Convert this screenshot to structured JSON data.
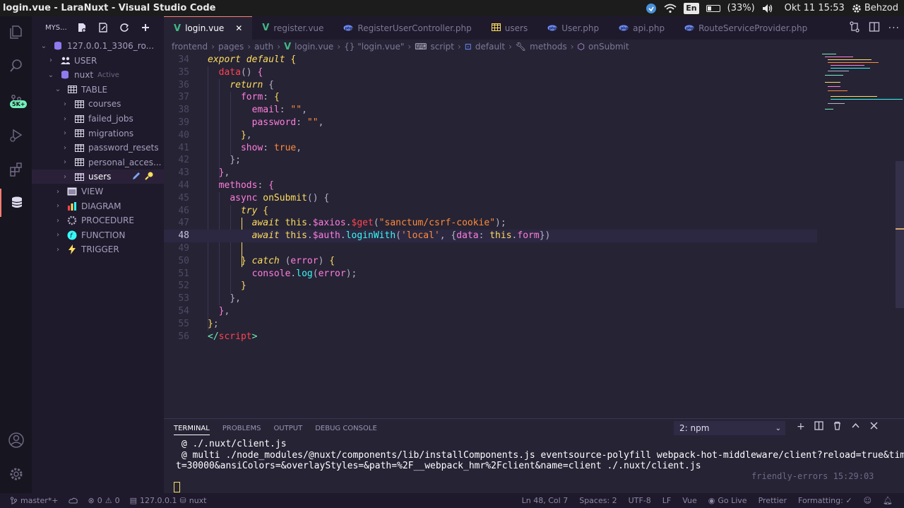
{
  "os": {
    "window_title": "login.vue - LaraNuxt - Visual Studio Code",
    "language": "En",
    "battery": "(33%)",
    "datetime": "Okt 11 15:53",
    "user": "Behzod"
  },
  "activity": {
    "badge": "5K+"
  },
  "sidebar": {
    "header": "MYS...",
    "tree": [
      {
        "label": "127.0.0.1_3306_ro...",
        "depth": 0,
        "chev": "⌄",
        "icon": "db"
      },
      {
        "label": "USER",
        "depth": 1,
        "chev": "›",
        "icon": "users"
      },
      {
        "label": "nuxt",
        "depth": 1,
        "chev": "⌄",
        "icon": "db",
        "tag": "Active"
      },
      {
        "label": "TABLE",
        "depth": 2,
        "chev": "⌄",
        "icon": "table"
      },
      {
        "label": "courses",
        "depth": 3,
        "chev": "›",
        "icon": "table"
      },
      {
        "label": "failed_jobs",
        "depth": 3,
        "chev": "›",
        "icon": "table"
      },
      {
        "label": "migrations",
        "depth": 3,
        "chev": "›",
        "icon": "table"
      },
      {
        "label": "password_resets",
        "depth": 3,
        "chev": "›",
        "icon": "table"
      },
      {
        "label": "personal_acces...",
        "depth": 3,
        "chev": "›",
        "icon": "table"
      },
      {
        "label": "users",
        "depth": 3,
        "chev": "›",
        "icon": "table",
        "selected": true
      },
      {
        "label": "VIEW",
        "depth": 2,
        "chev": "›",
        "icon": "view"
      },
      {
        "label": "DIAGRAM",
        "depth": 2,
        "chev": "›",
        "icon": "diagram"
      },
      {
        "label": "PROCEDURE",
        "depth": 2,
        "chev": "›",
        "icon": "procedure"
      },
      {
        "label": "FUNCTION",
        "depth": 2,
        "chev": "›",
        "icon": "function"
      },
      {
        "label": "TRIGGER",
        "depth": 2,
        "chev": "›",
        "icon": "trigger"
      }
    ]
  },
  "tabs": [
    {
      "label": "login.vue",
      "kind": "vue",
      "active": true
    },
    {
      "label": "register.vue",
      "kind": "vue"
    },
    {
      "label": "RegisterUserController.php",
      "kind": "php"
    },
    {
      "label": "users",
      "kind": "table"
    },
    {
      "label": "User.php",
      "kind": "php"
    },
    {
      "label": "api.php",
      "kind": "php"
    },
    {
      "label": "RouteServiceProvider.php",
      "kind": "php"
    }
  ],
  "breadcrumbs": [
    "frontend",
    "pages",
    "auth",
    "login.vue",
    "{} \"login.vue\"",
    "script",
    "default",
    "methods",
    "onSubmit"
  ],
  "editor": {
    "current_line": 48,
    "lines": [
      {
        "n": 34,
        "tokens": [
          [
            "kwi",
            "export default"
          ],
          [
            "pl",
            " "
          ],
          [
            "kw",
            "{"
          ]
        ]
      },
      {
        "n": 35,
        "tokens": [
          [
            "pl",
            "  "
          ],
          [
            "fnp",
            "data"
          ],
          [
            "pl",
            "() "
          ],
          [
            "prop",
            "{"
          ]
        ]
      },
      {
        "n": 36,
        "tokens": [
          [
            "pl",
            "    "
          ],
          [
            "kwi",
            "return"
          ],
          [
            "pl",
            " {"
          ]
        ]
      },
      {
        "n": 37,
        "tokens": [
          [
            "pl",
            "      "
          ],
          [
            "prop",
            "form"
          ],
          [
            "pl",
            ": "
          ],
          [
            "kw",
            "{"
          ]
        ]
      },
      {
        "n": 38,
        "tokens": [
          [
            "pl",
            "        "
          ],
          [
            "prop",
            "email"
          ],
          [
            "pl",
            ": "
          ],
          [
            "str",
            "\"\""
          ],
          [
            "pl",
            ","
          ]
        ]
      },
      {
        "n": 39,
        "tokens": [
          [
            "pl",
            "        "
          ],
          [
            "prop",
            "password"
          ],
          [
            "pl",
            ": "
          ],
          [
            "str",
            "\"\""
          ],
          [
            "pl",
            ","
          ]
        ]
      },
      {
        "n": 40,
        "tokens": [
          [
            "pl",
            "      "
          ],
          [
            "kw",
            "}"
          ],
          [
            "pl",
            ","
          ]
        ]
      },
      {
        "n": 41,
        "tokens": [
          [
            "pl",
            "      "
          ],
          [
            "prop",
            "show"
          ],
          [
            "pl",
            ": "
          ],
          [
            "str",
            "true"
          ],
          [
            "pl",
            ","
          ]
        ]
      },
      {
        "n": 42,
        "tokens": [
          [
            "pl",
            "    "
          ],
          [
            "pl",
            "};"
          ]
        ]
      },
      {
        "n": 43,
        "tokens": [
          [
            "pl",
            "  "
          ],
          [
            "prop",
            "}"
          ],
          [
            "pl",
            ","
          ]
        ]
      },
      {
        "n": 44,
        "tokens": [
          [
            "pl",
            "  "
          ],
          [
            "prop",
            "methods"
          ],
          [
            "pl",
            ": "
          ],
          [
            "prop",
            "{"
          ]
        ]
      },
      {
        "n": 45,
        "tokens": [
          [
            "pl",
            "    "
          ],
          [
            "prop",
            "async"
          ],
          [
            "pl",
            " "
          ],
          [
            "kw",
            "onSubmit"
          ],
          [
            "pl",
            "() {"
          ]
        ]
      },
      {
        "n": 46,
        "tokens": [
          [
            "pl",
            "      "
          ],
          [
            "kwi",
            "try"
          ],
          [
            "pl",
            " "
          ],
          [
            "kw",
            "{"
          ]
        ]
      },
      {
        "n": 47,
        "tokens": [
          [
            "pl",
            "        "
          ],
          [
            "kwi",
            "await"
          ],
          [
            "pl",
            " "
          ],
          [
            "th",
            "this"
          ],
          [
            "pl",
            "."
          ],
          [
            "prop",
            "$axios"
          ],
          [
            "pl",
            "."
          ],
          [
            "fnp",
            "$get"
          ],
          [
            "pl",
            "("
          ],
          [
            "str",
            "\"sanctum/csrf-cookie\""
          ],
          [
            "pl",
            ");"
          ]
        ]
      },
      {
        "n": 48,
        "tokens": [
          [
            "pl",
            "        "
          ],
          [
            "kwi",
            "await"
          ],
          [
            "pl",
            " "
          ],
          [
            "th",
            "this"
          ],
          [
            "pl",
            "."
          ],
          [
            "prop",
            "$auth"
          ],
          [
            "pl",
            "."
          ],
          [
            "fn",
            "loginWith"
          ],
          [
            "pl",
            "("
          ],
          [
            "str",
            "'local'"
          ],
          [
            "pl",
            ", {"
          ],
          [
            "prop",
            "data"
          ],
          [
            "pl",
            ": "
          ],
          [
            "th",
            "this"
          ],
          [
            "pl",
            "."
          ],
          [
            "prop",
            "form"
          ],
          [
            "pl",
            "})"
          ]
        ]
      },
      {
        "n": 49,
        "tokens": []
      },
      {
        "n": 50,
        "tokens": [
          [
            "pl",
            "      "
          ],
          [
            "kw",
            "}"
          ],
          [
            "pl",
            " "
          ],
          [
            "kwi",
            "catch"
          ],
          [
            "pl",
            " ("
          ],
          [
            "prop",
            "error"
          ],
          [
            "pl",
            ") "
          ],
          [
            "kw",
            "{"
          ]
        ]
      },
      {
        "n": 51,
        "tokens": [
          [
            "pl",
            "        "
          ],
          [
            "prop",
            "console"
          ],
          [
            "pl",
            "."
          ],
          [
            "fn",
            "log"
          ],
          [
            "pl",
            "("
          ],
          [
            "prop",
            "error"
          ],
          [
            "pl",
            ");"
          ]
        ]
      },
      {
        "n": 52,
        "tokens": [
          [
            "pl",
            "      "
          ],
          [
            "kw",
            "}"
          ]
        ]
      },
      {
        "n": 53,
        "tokens": [
          [
            "pl",
            "    "
          ],
          [
            "pl",
            "},"
          ]
        ]
      },
      {
        "n": 54,
        "tokens": [
          [
            "pl",
            "  "
          ],
          [
            "prop",
            "}"
          ],
          [
            "pl",
            ","
          ]
        ]
      },
      {
        "n": 55,
        "tokens": [
          [
            "kw",
            "}"
          ],
          [
            "pl",
            ";"
          ]
        ]
      },
      {
        "n": 56,
        "tokens": [
          [
            "tag",
            "</"
          ],
          [
            "red",
            "script"
          ],
          [
            "tag",
            ">"
          ]
        ]
      }
    ]
  },
  "panel": {
    "tabs": [
      "TERMINAL",
      "PROBLEMS",
      "OUTPUT",
      "DEBUG CONSOLE"
    ],
    "active_tab": "TERMINAL",
    "terminal_select": "2: npm",
    "terminal_lines": [
      " @ ./.nuxt/client.js",
      " @ multi ./node_modules/@nuxt/components/lib/installComponents.js eventsource-polyfill webpack-hot-middleware/client?reload=true&timeou",
      "t=30000&ansiColors=&overlayStyles=&path=%2F__webpack_hmr%2Fclient&name=client ./.nuxt/client.js"
    ],
    "terminal_note": "friendly-errors 15:29:03"
  },
  "status": {
    "branch": "master*+",
    "errors": "0",
    "warnings": "0",
    "db_host": "127.0.0.1",
    "db_name": "nuxt",
    "position": "Ln 48, Col 7",
    "spaces": "Spaces: 2",
    "encoding": "UTF-8",
    "eol": "LF",
    "language": "Vue",
    "golive": "Go Live",
    "prettier": "Prettier",
    "formatting": "Formatting: ✓"
  }
}
